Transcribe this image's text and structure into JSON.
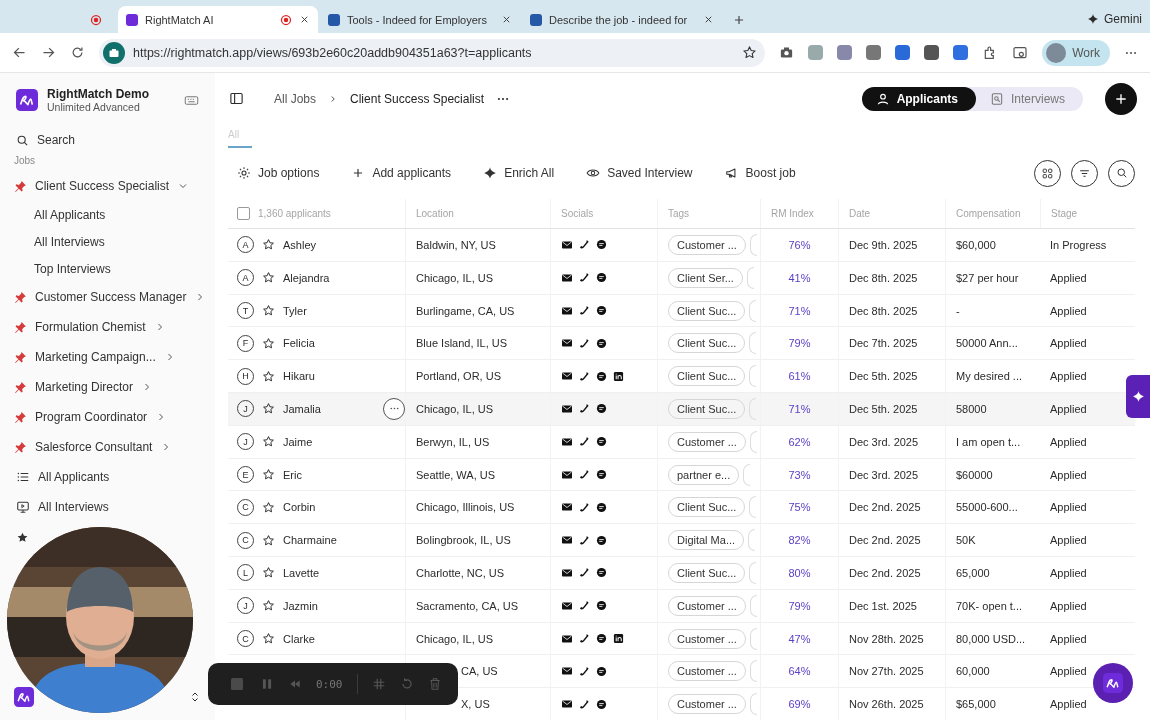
{
  "browser": {
    "tabs": [
      {
        "selected": false,
        "recording": true
      },
      {
        "title": "RightMatch AI",
        "selected": true,
        "recording": true
      },
      {
        "title": "Tools - Indeed for Employers",
        "selected": false,
        "recording": false
      },
      {
        "title": "Describe the job - indeed for",
        "selected": false,
        "recording": false
      }
    ],
    "assistant": "Gemini",
    "url": "https://rightmatch.app/views/693b2e60c20addb904351a63?t=applicants",
    "profile": "Work"
  },
  "workspace": {
    "name": "RightMatch Demo",
    "plan": "Unlimited Advanced"
  },
  "sidebar": {
    "search": "Search",
    "section": "Jobs",
    "jobs": [
      {
        "label": "Client Success Specialist",
        "expanded": true,
        "children": [
          {
            "label": "All Applicants"
          },
          {
            "label": "All Interviews"
          },
          {
            "label": "Top Interviews"
          }
        ]
      },
      {
        "label": "Customer Success Manager",
        "expanded": false
      },
      {
        "label": "Formulation Chemist",
        "expanded": false
      },
      {
        "label": "Marketing Campaign...",
        "expanded": false
      },
      {
        "label": "Marketing Director",
        "expanded": false
      },
      {
        "label": "Program Coordinator",
        "expanded": false
      },
      {
        "label": "Salesforce Consultant",
        "expanded": false
      }
    ],
    "links": [
      {
        "kind": "list",
        "label": "All Applicants"
      },
      {
        "kind": "monitor",
        "label": "All Interviews"
      },
      {
        "kind": "star"
      }
    ]
  },
  "breadcrumb": [
    "All Jobs",
    "Client Success Specialist"
  ],
  "views": [
    {
      "label": "Applicants",
      "selected": true
    },
    {
      "label": "Interviews",
      "selected": false
    }
  ],
  "tabs": [
    {
      "label": "All",
      "selected": true
    }
  ],
  "actions": [
    {
      "kind": "gear",
      "label": "Job options"
    },
    {
      "kind": "plus",
      "label": "Add applicants"
    },
    {
      "kind": "sparkle",
      "label": "Enrich All"
    },
    {
      "kind": "eye",
      "label": "Saved Interview"
    },
    {
      "kind": "megaphone",
      "label": "Boost job"
    }
  ],
  "table": {
    "all_selected": false,
    "count": "1,360 applicants",
    "columns": [
      "Location",
      "Socials",
      "Tags",
      "RM Index",
      "Date",
      "Compensation",
      "Stage"
    ],
    "rows": [
      {
        "initial": "A",
        "name": "Ashley",
        "starred": false,
        "location": "Baldwin, NY, US",
        "linkedin": false,
        "tag": "Customer ...",
        "rm": "76%",
        "date": "Dec 9th. 2025",
        "comp": "$60,000",
        "stage": "In Progress",
        "hovered": false
      },
      {
        "initial": "A",
        "name": "Alejandra",
        "starred": false,
        "location": "Chicago, IL, US",
        "linkedin": false,
        "tag": "Client Ser...",
        "rm": "41%",
        "date": "Dec 8th. 2025",
        "comp": "$27 per hour",
        "stage": "Applied",
        "hovered": false
      },
      {
        "initial": "T",
        "name": "Tyler",
        "starred": false,
        "location": "Burlingame, CA, US",
        "linkedin": false,
        "tag": "Client Suc...",
        "rm": "71%",
        "date": "Dec 8th. 2025",
        "comp": "-",
        "stage": "Applied",
        "hovered": false
      },
      {
        "initial": "F",
        "name": "Felicia",
        "starred": false,
        "location": "Blue Island, IL, US",
        "linkedin": false,
        "tag": "Client Suc...",
        "rm": "79%",
        "date": "Dec 7th. 2025",
        "comp": "50000 Ann...",
        "stage": "Applied",
        "hovered": false
      },
      {
        "initial": "H",
        "name": "Hikaru",
        "starred": false,
        "location": "Portland, OR, US",
        "linkedin": true,
        "tag": "Client Suc...",
        "rm": "61%",
        "date": "Dec 5th. 2025",
        "comp": "My desired ...",
        "stage": "Applied",
        "hovered": false
      },
      {
        "initial": "J",
        "name": "Jamalia",
        "starred": false,
        "location": "Chicago, IL, US",
        "linkedin": false,
        "tag": "Client Suc...",
        "rm": "71%",
        "date": "Dec 5th. 2025",
        "comp": "58000",
        "stage": "Applied",
        "hovered": true
      },
      {
        "initial": "J",
        "name": "Jaime",
        "starred": false,
        "location": "Berwyn, IL, US",
        "linkedin": false,
        "tag": "Customer ...",
        "rm": "62%",
        "date": "Dec 3rd. 2025",
        "comp": "I am open t...",
        "stage": "Applied",
        "hovered": false
      },
      {
        "initial": "E",
        "name": "Eric",
        "starred": false,
        "location": "Seattle, WA, US",
        "linkedin": false,
        "tag": "partner e...",
        "rm": "73%",
        "date": "Dec 3rd. 2025",
        "comp": "$60000",
        "stage": "Applied",
        "hovered": false
      },
      {
        "initial": "C",
        "name": "Corbin",
        "starred": false,
        "location": "Chicago, Illinois, US",
        "linkedin": false,
        "tag": "Client Suc...",
        "rm": "75%",
        "date": "Dec 2nd. 2025",
        "comp": "55000-600...",
        "stage": "Applied",
        "hovered": false
      },
      {
        "initial": "C",
        "name": "Charmaine",
        "starred": false,
        "location": "Bolingbrook, IL, US",
        "linkedin": false,
        "tag": "Digital Ma...",
        "rm": "82%",
        "date": "Dec 2nd. 2025",
        "comp": "50K",
        "stage": "Applied",
        "hovered": false
      },
      {
        "initial": "L",
        "name": "Lavette",
        "starred": false,
        "location": "Charlotte, NC, US",
        "linkedin": false,
        "tag": "Client Suc...",
        "rm": "80%",
        "date": "Dec 2nd. 2025",
        "comp": "65,000",
        "stage": "Applied",
        "hovered": false
      },
      {
        "initial": "J",
        "name": "Jazmin",
        "starred": false,
        "location": "Sacramento, CA, US",
        "linkedin": false,
        "tag": "Customer ...",
        "rm": "79%",
        "date": "Dec 1st. 2025",
        "comp": "70K- open t...",
        "stage": "Applied",
        "hovered": false
      },
      {
        "initial": "C",
        "name": "Clarke",
        "starred": false,
        "location": "Chicago, IL, US",
        "linkedin": true,
        "tag": "Customer ...",
        "rm": "47%",
        "date": "Nov 28th. 2025",
        "comp": "80,000 USD...",
        "stage": "Applied",
        "hovered": false
      },
      {
        "location": "CA, US",
        "linkedin": false,
        "tag": "Customer ...",
        "rm": "64%",
        "date": "Nov 27th. 2025",
        "comp": "60,000",
        "stage": "Applied",
        "hovered": false
      },
      {
        "location": "X, US",
        "linkedin": false,
        "tag": "Customer ...",
        "rm": "69%",
        "date": "Nov 26th. 2025",
        "comp": "$65,000",
        "stage": "Applied",
        "hovered": false
      }
    ]
  },
  "recorder": {
    "time": "0:00"
  }
}
